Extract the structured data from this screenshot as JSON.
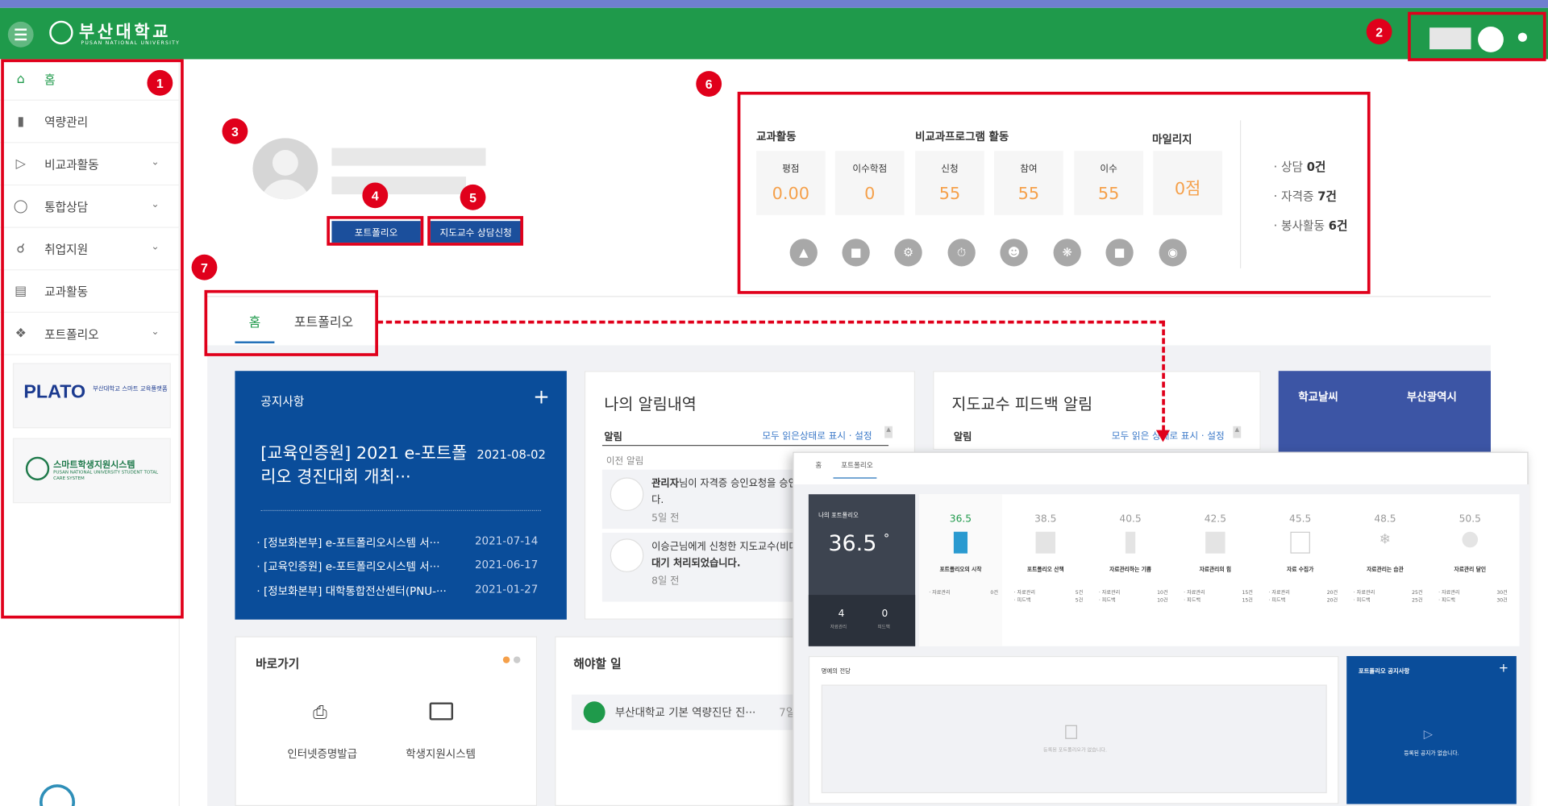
{
  "header": {
    "logo_text": "부산대학교",
    "logo_sub": "PUSAN NATIONAL UNIVERSITY"
  },
  "sidebar": {
    "items": [
      {
        "label": "홈",
        "icon": "home-icon"
      },
      {
        "label": "역량관리",
        "icon": "bar-chart-icon"
      },
      {
        "label": "비교과활동",
        "icon": "flag-icon"
      },
      {
        "label": "통합상담",
        "icon": "chat-icon"
      },
      {
        "label": "취업지원",
        "icon": "share-icon"
      },
      {
        "label": "교과활동",
        "icon": "document-icon"
      },
      {
        "label": "포트폴리오",
        "icon": "cube-icon"
      }
    ],
    "plato_logo": "PLATO",
    "plato_sub": "부산대학교 스마트 교육플랫폼",
    "smart_title": "스마트학생지원시스템",
    "smart_sub": "PUSAN NATIONAL UNIVERSITY STUDENT TOTAL CARE SYSTEM"
  },
  "profile": {
    "portfolio_button": "포트폴리오",
    "advisor_button": "지도교수 상담신청"
  },
  "stats": {
    "group_curricular": "교과활동",
    "group_extracurricular": "비교과프로그램 활동",
    "group_mileage": "마일리지",
    "boxes": [
      {
        "label": "평점",
        "value": "0.00"
      },
      {
        "label": "이수학점",
        "value": "0"
      },
      {
        "label": "신청",
        "value": "55"
      },
      {
        "label": "참여",
        "value": "55"
      },
      {
        "label": "이수",
        "value": "55"
      }
    ],
    "mileage_value": "0점",
    "side": [
      {
        "label": "상담",
        "value": "0건"
      },
      {
        "label": "자격증",
        "value": "7건"
      },
      {
        "label": "봉사활동",
        "value": "6건"
      }
    ]
  },
  "tabs": {
    "home": "홈",
    "portfolio": "포트폴리오"
  },
  "notice": {
    "title": "공지사항",
    "plus": "+",
    "headline": "[교육인증원] 2021 e-포트폴리오 경진대회 개최···",
    "headline_date": "2021-08-02",
    "rows": [
      {
        "text": "[정보화본부] e-포트폴리오시스템 서···",
        "date": "2021-07-14"
      },
      {
        "text": "[교육인증원] e-포트폴리오시스템 서···",
        "date": "2021-06-17"
      },
      {
        "text": "[정보화본부] 대학통합전산센터(PNU-···",
        "date": "2021-01-27"
      }
    ]
  },
  "my_alerts": {
    "title": "나의 알림내역",
    "head": "알림",
    "link": "모두 읽은상태로 표시 · 설정",
    "prev": "이전 알림",
    "items": [
      {
        "name": "관리자",
        "text": "님이 자격증 승인요청을 승인",
        "cont": "다.",
        "time": "5일 전"
      },
      {
        "text": "이승근님에게 신청한 지도교수(비대",
        "text2": "대기 처리되었습니다.",
        "time": "8일 전"
      }
    ]
  },
  "advisor_alerts": {
    "title": "지도교수 피드백 알림",
    "head": "알림",
    "link": "모두 읽은 상태로 표시 · 설정"
  },
  "weather": {
    "left": "학교날씨",
    "right": "부산광역시"
  },
  "quick": {
    "title": "바로가기",
    "items": [
      "인터넷증명발급",
      "학생지원시스템"
    ]
  },
  "todo": {
    "title": "해야할 일",
    "item": "부산대학교 기본 역량진단 진···",
    "item_suffix": "7일"
  },
  "overlay": {
    "tab_home": "홈",
    "tab_portfolio": "포트폴리오",
    "my_portfolio": "나의 포트폴리오",
    "score": "36.5",
    "degree": "°",
    "count_left": "4",
    "count_left_label": "자료관리",
    "count_right": "0",
    "count_right_label": "피드백",
    "steps": [
      {
        "score": "36.5",
        "name": "포트폴리오의 시작",
        "lines": [
          [
            "· 자료관리",
            "0건"
          ]
        ]
      },
      {
        "score": "38.5",
        "name": "포트폴리오 산책",
        "lines": [
          [
            "· 자료관리",
            "5건"
          ],
          [
            "· 피드백",
            "5건"
          ]
        ]
      },
      {
        "score": "40.5",
        "name": "자료관리하는 기쁨",
        "lines": [
          [
            "· 자료관리",
            "10건"
          ],
          [
            "· 피드백",
            "10건"
          ]
        ]
      },
      {
        "score": "42.5",
        "name": "자료관리의 힘",
        "lines": [
          [
            "· 자료관리",
            "15건"
          ],
          [
            "· 피드백",
            "15건"
          ]
        ]
      },
      {
        "score": "45.5",
        "name": "자료 수집가",
        "lines": [
          [
            "· 자료관리",
            "20건"
          ],
          [
            "· 피드백",
            "20건"
          ]
        ]
      },
      {
        "score": "48.5",
        "name": "자료관리는 습관",
        "lines": [
          [
            "· 자료관리",
            "25건"
          ],
          [
            "· 피드백",
            "25건"
          ]
        ]
      },
      {
        "score": "50.5",
        "name": "자료관리 달인",
        "lines": [
          [
            "· 자료관리",
            "30건"
          ],
          [
            "· 피드백",
            "30건"
          ]
        ]
      }
    ],
    "honor_title": "명예의 전당",
    "honor_empty": "등록된 포트폴리오가 없습니다.",
    "notice_title": "포트폴리오 공지사항",
    "notice_plus": "+",
    "notice_empty": "등록된 공지가 없습니다."
  },
  "annotations": [
    "1",
    "2",
    "3",
    "4",
    "5",
    "6",
    "7"
  ],
  "colors": {
    "brand_green": "#1f9a4b",
    "navy": "#0a4d9a",
    "accent_orange": "#f5a04a",
    "annotation_red": "#e0001b"
  }
}
